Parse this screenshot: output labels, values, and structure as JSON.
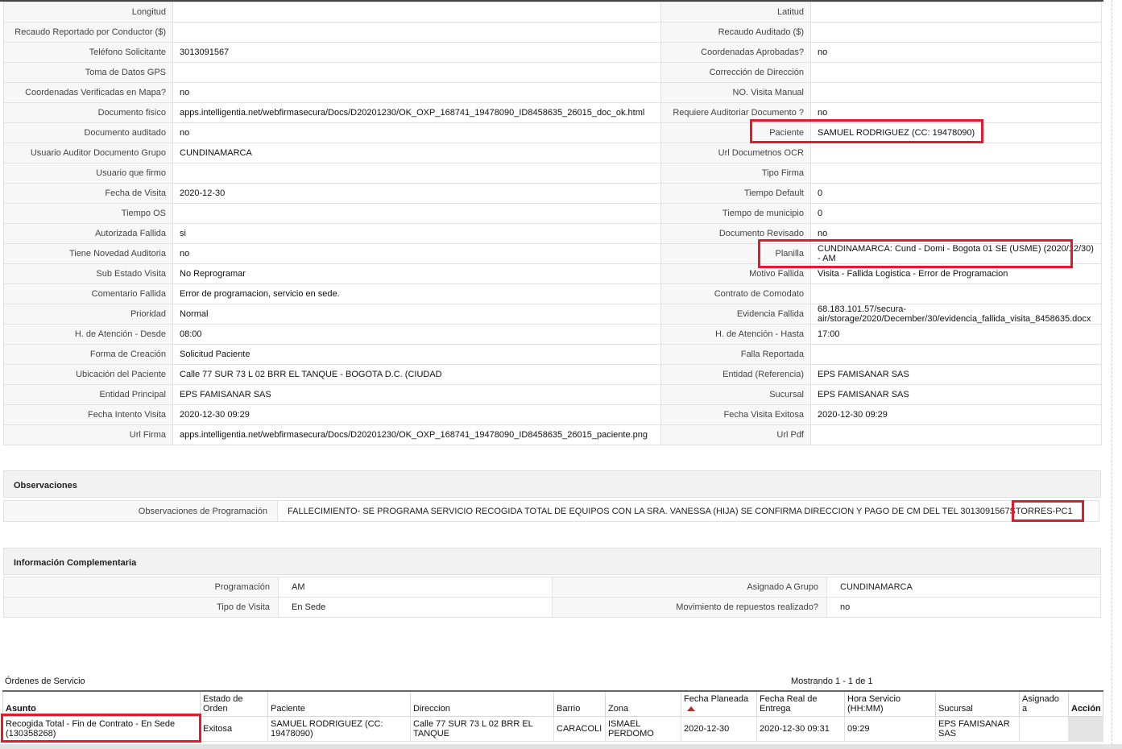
{
  "detail_rows": [
    {
      "l1": "Longitud",
      "v1": "",
      "l2": "Latitud",
      "v2": ""
    },
    {
      "l1": "Recaudo Reportado por Conductor ($)",
      "v1": "",
      "l2": "Recaudo Auditado ($)",
      "v2": ""
    },
    {
      "l1": "Teléfono Solicitante",
      "v1": "3013091567",
      "l2": "Coordenadas Aprobadas?",
      "v2": "no"
    },
    {
      "l1": "Toma de Datos GPS",
      "v1": "",
      "l2": "Corrección de Dirección",
      "v2": ""
    },
    {
      "l1": "Coordenadas Verificadas en Mapa?",
      "v1": "no",
      "l2": "NO. Visita Manual",
      "v2": ""
    },
    {
      "l1": "Documento fisico",
      "v1": "apps.intelligentia.net/webfirmasecura/Docs/D20201230/OK_OXP_168741_19478090_ID8458635_26015_doc_ok.html",
      "l2": "Requiere Auditoriar Documento ?",
      "v2": "no"
    },
    {
      "l1": "Documento auditado",
      "v1": "no",
      "l2": "Paciente",
      "v2": "SAMUEL RODRIGUEZ (CC: 19478090)"
    },
    {
      "l1": "Usuario Auditor Documento Grupo",
      "v1": "CUNDINAMARCA",
      "l2": "Url Documetnos OCR",
      "v2": ""
    },
    {
      "l1": "Usuario que firmo",
      "v1": "",
      "l2": "Tipo Firma",
      "v2": ""
    },
    {
      "l1": "Fecha de Visita",
      "v1": "2020-12-30",
      "l2": "Tiempo Default",
      "v2": "0"
    },
    {
      "l1": "Tiempo OS",
      "v1": "",
      "l2": "Tiempo de municipio",
      "v2": "0"
    },
    {
      "l1": "Autorizada Fallida",
      "v1": "si",
      "l2": "Documento Revisado",
      "v2": "no"
    },
    {
      "l1": "Tiene Novedad Auditoria",
      "v1": "no",
      "l2": "Planilla",
      "v2": "CUNDINAMARCA: Cund - Domi - Bogota 01 SE (USME) (2020/12/30) - AM"
    },
    {
      "l1": "Sub Estado Visita",
      "v1": "No Reprogramar",
      "l2": "Motivo Fallida",
      "v2": "Visita - Fallida Logistica - Error de Programacion"
    },
    {
      "l1": "Comentario Fallida",
      "v1": "Error de programacion, servicio en sede.",
      "l2": "Contrato de Comodato",
      "v2": ""
    },
    {
      "l1": "Prioridad",
      "v1": "Normal",
      "l2": "Evidencia Fallida",
      "v2": "68.183.101.57/secura-air/storage/2020/December/30/evidencia_fallida_visita_8458635.docx"
    },
    {
      "l1": "H. de Atención - Desde",
      "v1": "08:00",
      "l2": "H. de Atención - Hasta",
      "v2": "17:00"
    },
    {
      "l1": "Forma de Creación",
      "v1": "Solicitud Paciente",
      "l2": "Falla Reportada",
      "v2": ""
    },
    {
      "l1": "Ubicación del Paciente",
      "v1": "Calle 77 SUR 73 L 02 BRR EL TANQUE - BOGOTA D.C. (CIUDAD",
      "l2": "Entidad (Referencia)",
      "v2": "EPS FAMISANAR SAS"
    },
    {
      "l1": "Entidad Principal",
      "v1": "EPS FAMISANAR SAS",
      "l2": "Sucursal",
      "v2": "EPS FAMISANAR SAS"
    },
    {
      "l1": "Fecha Intento Visita",
      "v1": "2020-12-30 09:29",
      "l2": "Fecha Visita Exitosa",
      "v2": "2020-12-30 09:29"
    },
    {
      "l1": "Url Firma",
      "v1": "apps.intelligentia.net/webfirmasecura/Docs/D20201230/OK_OXP_168741_19478090_ID8458635_26015_paciente.png",
      "l2": "Url Pdf",
      "v2": ""
    }
  ],
  "observaciones": {
    "title": "Observaciones",
    "label": "Observaciones de Programación",
    "value": "FALLECIMIENTO- SE PROGRAMA SERVICIO RECOGIDA TOTAL DE EQUIPOS CON LA SRA. VANESSA (HIJA) SE CONFIRMA DIRECCION Y PAGO DE CM DEL TEL 3013091567STORRES-PC1"
  },
  "complementaria": {
    "title": "Información Complementaria",
    "rows": [
      {
        "l1": "Programación",
        "v1": "AM",
        "l2": "Asignado A Grupo",
        "v2": "CUNDINAMARCA"
      },
      {
        "l1": "Tipo de Visita",
        "v1": "En Sede",
        "l2": "Movimiento de repuestos realizado?",
        "v2": "no"
      }
    ]
  },
  "ordenes": {
    "title": "Órdenes de Servicio",
    "showing": "Mostrando 1 - 1 de 1",
    "columns": [
      "Asunto",
      "Estado de Orden",
      "Paciente",
      "Direccion",
      "Barrio",
      "Zona",
      "Fecha Planeada",
      "Fecha Real de Entrega",
      "Hora Servicio (HH:MM)",
      "Sucursal",
      "Asignado a",
      "Acción"
    ],
    "sort_column": "Fecha Planeada",
    "sort_icon": "sort-up-icon",
    "rows": [
      [
        "Recogida Total - Fin de Contrato - En Sede (130358268)",
        "Exitosa",
        "SAMUEL RODRIGUEZ (CC: 19478090)",
        "Calle 77 SUR 73 L 02 BRR EL TANQUE",
        "CARACOLI",
        "ISMAEL PERDOMO",
        "2020-12-30",
        "2020-12-30 09:31",
        "09:29",
        "EPS FAMISANAR SAS",
        "",
        ""
      ]
    ]
  },
  "highlight_color": "#e01b2e"
}
